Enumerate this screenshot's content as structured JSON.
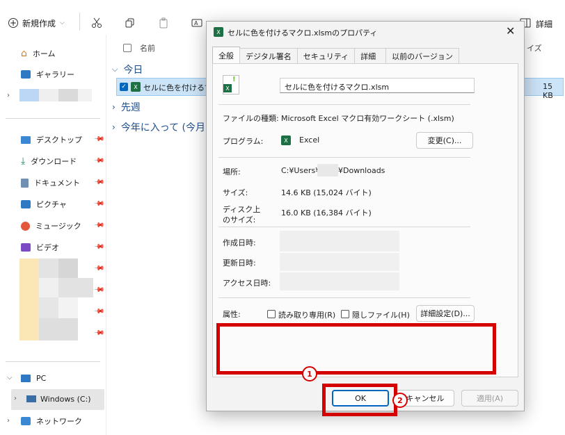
{
  "toolbar": {
    "new_label": "新規作成",
    "details_label": "詳細"
  },
  "sidebar": {
    "home": "ホーム",
    "gallery": "ギャラリー",
    "desktop": "デスクトップ",
    "downloads": "ダウンロード",
    "documents": "ドキュメント",
    "pictures": "ピクチャ",
    "music": "ミュージック",
    "videos": "ビデオ",
    "pc": "PC",
    "windows_c": "Windows (C:)",
    "network": "ネットワーク"
  },
  "main": {
    "col_name": "名前",
    "col_size": "イズ",
    "group_today": "今日",
    "file_name": "セルに色を付けるマク",
    "file_size": "15 KB",
    "group_last_week": "先週",
    "group_this_year": "今年に入って (今月は"
  },
  "dialog": {
    "title": "セルに色を付けるマクロ.xlsmのプロパティ",
    "tabs": [
      "全般",
      "デジタル署名",
      "セキュリティ",
      "詳細",
      "以前のバージョン"
    ],
    "file_name_value": "セルに色を付けるマクロ.xlsm",
    "file_type_label": "ファイルの種類:",
    "file_type_value": "Microsoft Excel マクロ有効ワークシート (.xlsm)",
    "program_label": "プログラム:",
    "program_value": "Excel",
    "change_button": "変更(C)...",
    "location_label": "場所:",
    "location_value_prefix": "C:¥Users¥",
    "location_value_suffix": "¥Downloads",
    "size_label": "サイズ:",
    "size_value": "14.6 KB (15,024 バイト)",
    "disk_size_label_1": "ディスク上",
    "disk_size_label_2": "のサイズ:",
    "disk_size_value": "16.0 KB (16,384 バイト)",
    "created_label": "作成日時:",
    "modified_label": "更新日時:",
    "accessed_label": "アクセス日時:",
    "attributes_label": "属性:",
    "readonly_label": "読み取り専用(R)",
    "hidden_label": "隠しファイル(H)",
    "advanced_button": "詳細設定(D)...",
    "ok_button": "OK",
    "cancel_button": "キャンセル",
    "apply_button": "適用(A)"
  },
  "annotations": {
    "marker1": "1",
    "marker2": "2"
  },
  "colors": {
    "accent": "#0067c0",
    "highlight": "#d40000",
    "excel_green": "#1d7044"
  }
}
